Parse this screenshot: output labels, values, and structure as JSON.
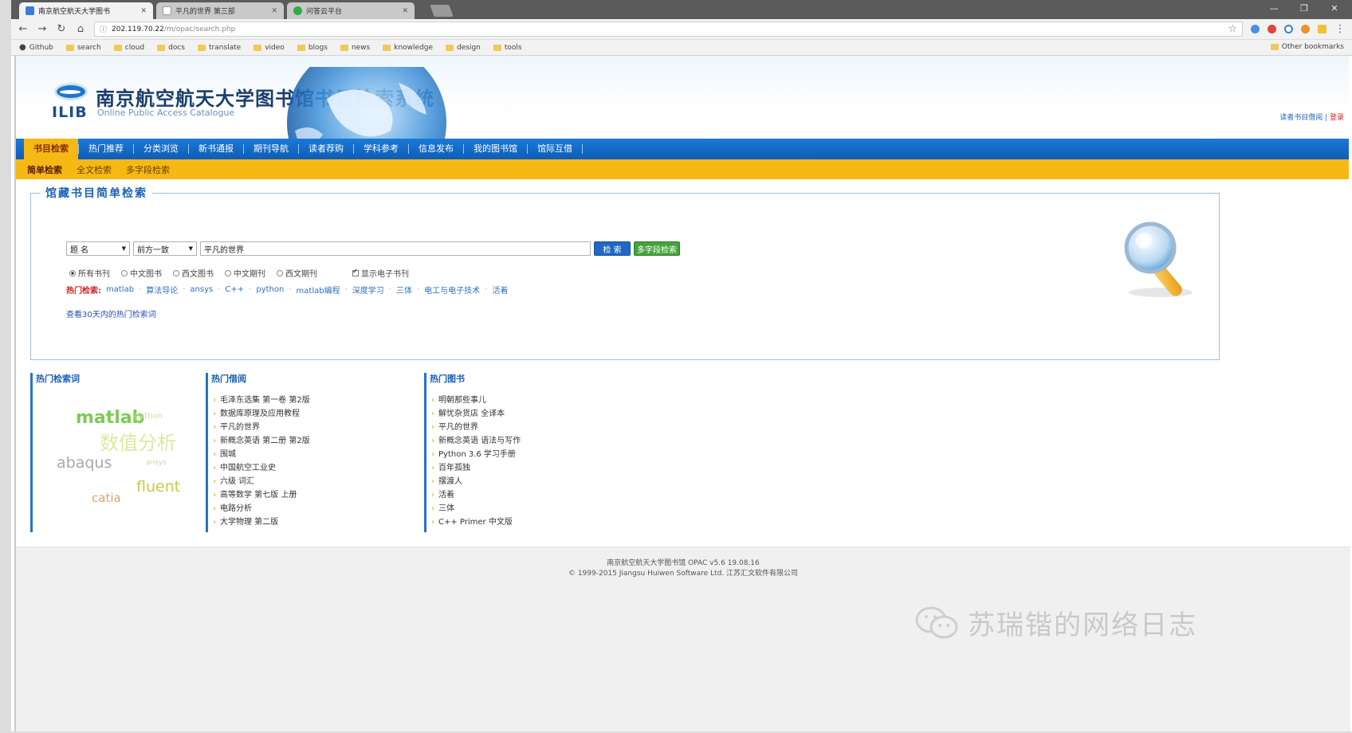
{
  "browser": {
    "tabs": [
      {
        "label": "南京航空航天大学图书",
        "active": true,
        "favicon_color": "#3a7bd5"
      },
      {
        "label": "平凡的世界 第三部",
        "active": false,
        "favicon_color": "#ffffff"
      },
      {
        "label": "问答云平台",
        "active": false,
        "favicon_color": "#2eaa4a"
      }
    ],
    "url_host": "202.119.70.22",
    "url_path": "/m/opac/search.php",
    "bookmarks": [
      "Github",
      "search",
      "cloud",
      "docs",
      "translate",
      "video",
      "blogs",
      "news",
      "knowledge",
      "design",
      "tools"
    ],
    "other_bookmarks": "Other bookmarks"
  },
  "header": {
    "logo_text": "ILIB",
    "title": "南京航空航天大学图书馆书目检索系统",
    "subtitle": "Online Public Access Catalogue",
    "link_login": "读者书目借阅",
    "link_logout": "登录"
  },
  "main_nav": [
    "书目检索",
    "热门推荐",
    "分类浏览",
    "新书通报",
    "期刊导航",
    "读者荐购",
    "学科参考",
    "信息发布",
    "我的图书馆",
    "馆际互借"
  ],
  "sub_nav": [
    "简单检索",
    "全文检索",
    "多字段检索"
  ],
  "search": {
    "legend": "馆藏书目简单检索",
    "field_select": "题 名",
    "match_select": "前方一致",
    "query": "平凡的世界",
    "search_btn": "检 索",
    "advanced_btn": "多字段检索",
    "options": [
      {
        "label": "所有书刊",
        "checked": true,
        "kind": "radio"
      },
      {
        "label": "中文图书",
        "checked": false,
        "kind": "radio"
      },
      {
        "label": "西文图书",
        "checked": false,
        "kind": "radio"
      },
      {
        "label": "中文期刊",
        "checked": false,
        "kind": "radio"
      },
      {
        "label": "西文期刊",
        "checked": false,
        "kind": "radio"
      },
      {
        "label": "显示电子书刊",
        "checked": true,
        "kind": "checkbox"
      }
    ],
    "hot_label": "热门检索:",
    "hot_keywords": [
      "matlab",
      "算法导论",
      "ansys",
      "C++",
      "python",
      "matlab编程",
      "深度学习",
      "三体",
      "电工与电子技术",
      "活着"
    ],
    "more_link": "查看30天内的热门检索词"
  },
  "columns": {
    "hot_search": {
      "title": "热门检索词",
      "cloud": [
        {
          "text": "matlab",
          "color": "#7ccc54"
        },
        {
          "text": "数值分析",
          "color": "#dde9a0"
        },
        {
          "text": "abaqus",
          "color": "#a8a8a8"
        },
        {
          "text": "fluent",
          "color": "#c9c94a"
        },
        {
          "text": "catia",
          "color": "#d9a66a"
        },
        {
          "text": "ansys",
          "color": "#d2d2a2"
        },
        {
          "text": "python",
          "color": "#c9dfa0"
        }
      ]
    },
    "hot_borrow": {
      "title": "热门借阅",
      "items": [
        "毛泽东选集 第一卷 第2版",
        "数据库原理及应用教程",
        "平凡的世界",
        "新概念英语 第二册 第2版",
        "围城",
        "中国航空工业史",
        "六级 词汇",
        "高等数学 第七版 上册",
        "电路分析",
        "大学物理 第二版"
      ]
    },
    "hot_books": {
      "title": "热门图书",
      "items": [
        "明朝那些事儿",
        "解忧杂货店 全译本",
        "平凡的世界",
        "新概念英语 语法与写作",
        "Python 3.6 学习手册",
        "百年孤独",
        "摆渡人",
        "活着",
        "三体",
        "C++ Primer 中文版"
      ]
    }
  },
  "footer": {
    "line1": "南京航空航天大学图书馆 OPAC v5.6 19.08.16",
    "line2": "© 1999-2015 Jiangsu Huiwen Software Ltd. 江苏汇文软件有限公司",
    "watermark": "苏瑞锴的网络日志"
  },
  "colors": {
    "nav_blue": "#1b79d6",
    "nav_gold": "#f6b815",
    "link_blue": "#2f6fc6",
    "hot_red": "#d2242a"
  }
}
